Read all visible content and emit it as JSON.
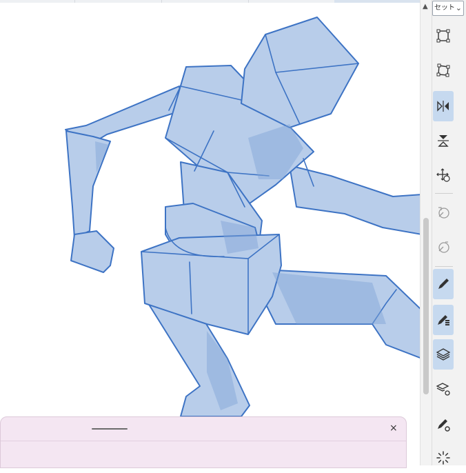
{
  "tool_set_select": {
    "value": "セット"
  },
  "tools": [
    {
      "name": "transform-tool",
      "active": false
    },
    {
      "name": "free-transform-tool",
      "active": false
    },
    {
      "name": "flip-horizontal-tool",
      "active": true
    },
    {
      "name": "flip-vertical-tool",
      "active": false
    },
    {
      "name": "move-rotate-tool",
      "active": false
    },
    {
      "name": "rotate-left-tool",
      "active": false
    },
    {
      "name": "rotate-right-tool",
      "active": false
    },
    {
      "name": "pen-tool",
      "active": true
    },
    {
      "name": "pen-layer-tool",
      "active": true
    },
    {
      "name": "layers-tool",
      "active": true
    },
    {
      "name": "layer-settings-tool",
      "active": false
    },
    {
      "name": "pen-settings-tool",
      "active": false
    },
    {
      "name": "loading-tool",
      "active": false
    }
  ],
  "bottom_sheet": {
    "close_label": "×"
  },
  "colors": {
    "fill": "#b8cdea",
    "stroke": "#3d73c4",
    "shade": "#7fa3d8",
    "accent": "#c6d9ef"
  }
}
